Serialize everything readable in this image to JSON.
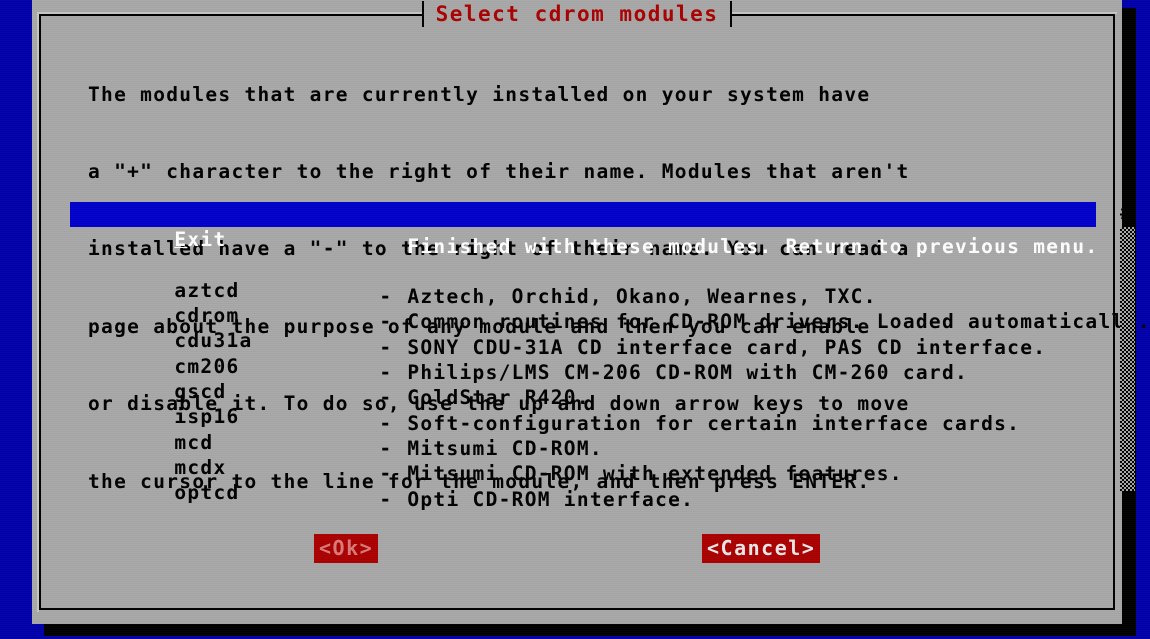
{
  "window": {
    "title": "Select cdrom modules",
    "title_color": "#aa0000",
    "background_color": "#a8a8a8",
    "desktop_color": "#0000aa"
  },
  "help_text": {
    "lines": [
      "The modules that are currently installed on your system have",
      "a \"+\" character to the right of their name. Modules that aren't",
      "installed have a \"-\" to the right of their name. You can read a",
      "page about the purpose of any module and then you can enable",
      "or disable it. To do so, use the up and down arrow keys to move",
      "the cursor to the line for the module, and then press ENTER."
    ]
  },
  "menu": {
    "selected_index": 0,
    "highlight_color": "#0000cc",
    "highlight_text_color": "#ffffff",
    "items": [
      {
        "tag": "Exit",
        "hotkey": "E",
        "tag_rest": "xit",
        "dash": "",
        "description": "Finished with these modules. Return to previous menu.",
        "selected": true
      },
      {
        "tag": "",
        "dash": "",
        "description": "",
        "spacer": true
      },
      {
        "tag": "aztcd",
        "dash": "-",
        "description": "Aztech, Orchid, Okano, Wearnes, TXC."
      },
      {
        "tag": "cdrom",
        "dash": "-",
        "description": "Common routines for CD-ROM drivers. Loaded automatically."
      },
      {
        "tag": "cdu31a",
        "dash": "-",
        "description": "SONY CDU-31A CD interface card, PAS CD interface."
      },
      {
        "tag": "cm206",
        "dash": "-",
        "description": "Philips/LMS CM-206 CD-ROM with CM-260 card."
      },
      {
        "tag": "gscd",
        "dash": "-",
        "description": "GoldStar R420."
      },
      {
        "tag": "isp16",
        "dash": "-",
        "description": "Soft-configuration for certain interface cards."
      },
      {
        "tag": "mcd",
        "dash": "-",
        "description": "Mitsumi CD-ROM."
      },
      {
        "tag": "mcdx",
        "dash": "-",
        "description": "Mitsumi CD-ROM with extended features."
      },
      {
        "tag": "optcd",
        "dash": "-",
        "description": "Opti CD-ROM interface."
      }
    ]
  },
  "scrollbar": {
    "up_marker": "#",
    "position": "top"
  },
  "buttons": {
    "ok_label": "<Ok>",
    "cancel_label": "<Cancel>",
    "ok_color": "#aa0000",
    "cancel_color": "#aa0000"
  }
}
